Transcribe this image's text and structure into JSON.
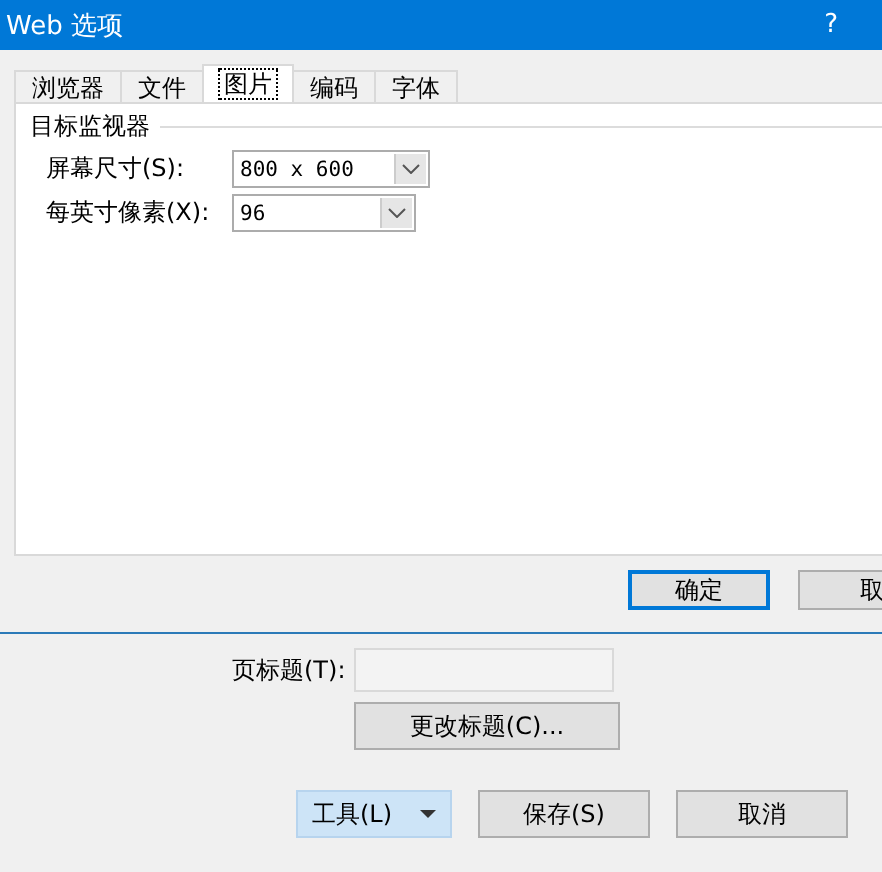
{
  "window": {
    "title": "Web 选项",
    "help": "?"
  },
  "tabs": [
    {
      "label": "浏览器",
      "selected": false
    },
    {
      "label": "文件",
      "selected": false
    },
    {
      "label": "图片",
      "selected": true
    },
    {
      "label": "编码",
      "selected": false
    },
    {
      "label": "字体",
      "selected": false
    }
  ],
  "group": {
    "title": "目标监视器",
    "fields": [
      {
        "label": "屏幕尺寸(S):",
        "value": "800 x 600"
      },
      {
        "label": "每英寸像素(X):",
        "value": "96"
      }
    ]
  },
  "dialog_buttons": [
    {
      "label": "确定",
      "default": true
    },
    {
      "label": "取",
      "default": false
    }
  ],
  "page_title": {
    "label": "页标题(T):",
    "change_button": "更改标题(C)..."
  },
  "footer_buttons": [
    {
      "label": "工具(L)",
      "kind": "dropdown",
      "hover": true
    },
    {
      "label": "保存(S)",
      "kind": "plain",
      "hover": false
    },
    {
      "label": "取消",
      "kind": "plain",
      "hover": false
    }
  ]
}
